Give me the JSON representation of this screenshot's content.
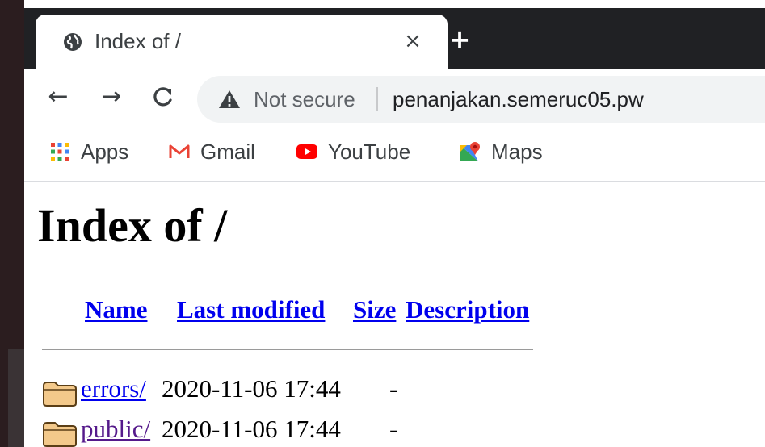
{
  "browser": {
    "tab": {
      "title": "Index of /",
      "close_glyph": "×",
      "favicon": "globe-icon"
    },
    "new_tab_glyph": "+",
    "nav": {
      "back_glyph": "←",
      "forward_glyph": "→",
      "reload_glyph": "C"
    },
    "omnibox": {
      "security_label": "Not secure",
      "url": "penanjakan.semeruc05.pw"
    },
    "bookmarks": [
      {
        "label": "Apps",
        "icon": "apps-grid-icon"
      },
      {
        "label": "Gmail",
        "icon": "gmail-icon"
      },
      {
        "label": "YouTube",
        "icon": "youtube-icon"
      },
      {
        "label": "Maps",
        "icon": "maps-icon"
      }
    ]
  },
  "page": {
    "title": "Index of /",
    "columns": {
      "name": "Name",
      "last_modified": "Last modified",
      "size": "Size",
      "description": "Description"
    },
    "entries": [
      {
        "name": "errors/",
        "last_modified": "2020-11-06 17:44",
        "size": "-",
        "visited": false
      },
      {
        "name": "public/",
        "last_modified": "2020-11-06 17:44",
        "size": "-",
        "visited": true
      }
    ]
  },
  "colors": {
    "link": "#0000ee",
    "visited_link": "#551a8b",
    "tabstrip": "#202124",
    "omnibox": "#f1f3f4"
  }
}
